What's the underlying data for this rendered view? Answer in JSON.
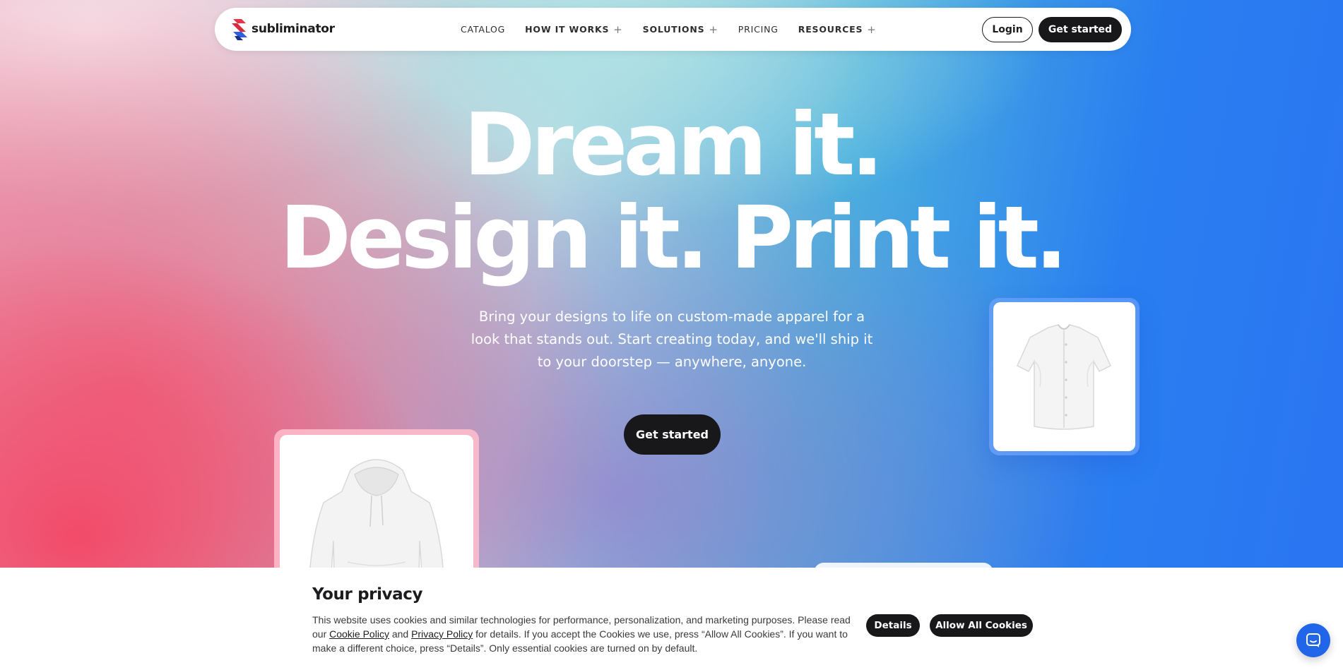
{
  "brand": {
    "name": "subliminator"
  },
  "nav": {
    "links": [
      {
        "label": "CATALOG",
        "has_plus": false
      },
      {
        "label": "HOW IT WORKS",
        "has_plus": true
      },
      {
        "label": "SOLUTIONS",
        "has_plus": true
      },
      {
        "label": "PRICING",
        "has_plus": false
      },
      {
        "label": "RESOURCES",
        "has_plus": true
      }
    ],
    "plus": "+",
    "login_label": "Login",
    "get_started_label": "Get started"
  },
  "hero": {
    "line1": "Dream it.",
    "line2": "Design it. Print it.",
    "subtitle": "Bring your designs to life on custom-made apparel for a look that stands out. Start creating today, and we'll ship it to your doorstep — anywhere, anyone.",
    "cta_label": "Get started"
  },
  "products": [
    {
      "name": "shirt-icon"
    },
    {
      "name": "hoodie-icon"
    }
  ],
  "cookie": {
    "title": "Your privacy",
    "text_before": "This website uses cookies and similar technologies for performance, personalization, and marketing purposes. Please read our ",
    "cookie_policy_link": "Cookie Policy",
    "and": " and ",
    "privacy_policy_link": "Privacy Policy",
    "text_after": " for details. If you accept the Cookies we use, press “Allow All Cookies”. If you want to make a different choice, press “Details”. Only essential cookies are turned on by default.",
    "details_label": "Details",
    "allow_label": "Allow All Cookies"
  },
  "colors": {
    "dark": "#18181a",
    "chat_blue": "#2166e8",
    "logo_red": "#e8324a",
    "logo_blue": "#2f5fe0"
  }
}
